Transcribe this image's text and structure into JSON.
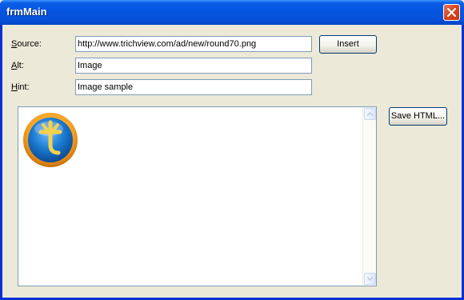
{
  "window": {
    "title": "frmMain"
  },
  "fields": {
    "source": {
      "label_key": "S",
      "label_rest": "ource:",
      "value": "http://www.trichview.com/ad/new/round70.png"
    },
    "alt": {
      "label_key": "A",
      "label_rest": "lt:",
      "value": "Image"
    },
    "hint": {
      "label_key": "H",
      "label_rest": "int:",
      "value": "Image sample"
    }
  },
  "buttons": {
    "insert": "Insert",
    "save_html": "Save HTML..."
  },
  "viewer": {
    "image_icon": "trichview-logo-icon"
  },
  "colors": {
    "title_bar": "#0454e0",
    "face": "#ece9d8",
    "logo_ring": "#f5a020",
    "logo_blue": "#1a7ad0"
  }
}
